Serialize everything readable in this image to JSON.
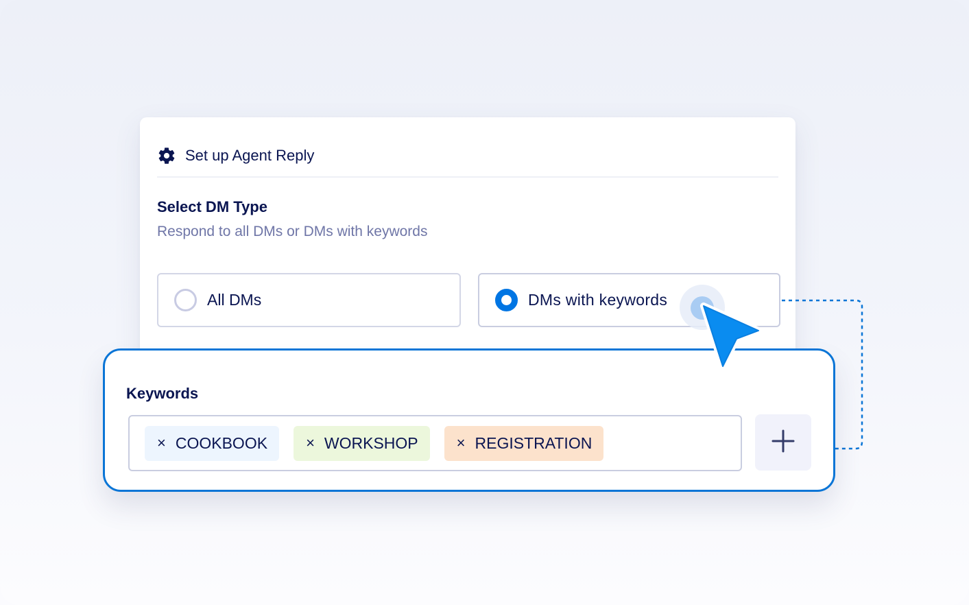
{
  "card": {
    "title": "Set up Agent Reply",
    "icon": "gear-icon"
  },
  "dm_type": {
    "title": "Select DM Type",
    "subtitle": "Respond to all DMs or DMs with keywords",
    "options": [
      {
        "label": "All DMs",
        "selected": false
      },
      {
        "label": "DMs with keywords",
        "selected": true
      }
    ]
  },
  "keywords": {
    "title": "Keywords",
    "tags": [
      {
        "label": "COOKBOOK",
        "remove": "×",
        "color": "#edf5fe"
      },
      {
        "label": "WORKSHOP",
        "remove": "×",
        "color": "#ecf7dc"
      },
      {
        "label": "REGISTRATION",
        "remove": "×",
        "color": "#fce2cc"
      }
    ],
    "add_button_icon": "plus-icon"
  },
  "colors": {
    "accent": "#0075e3",
    "text": "#0a1551",
    "muted": "#6f76a7",
    "panel_border": "#0a75d6"
  }
}
